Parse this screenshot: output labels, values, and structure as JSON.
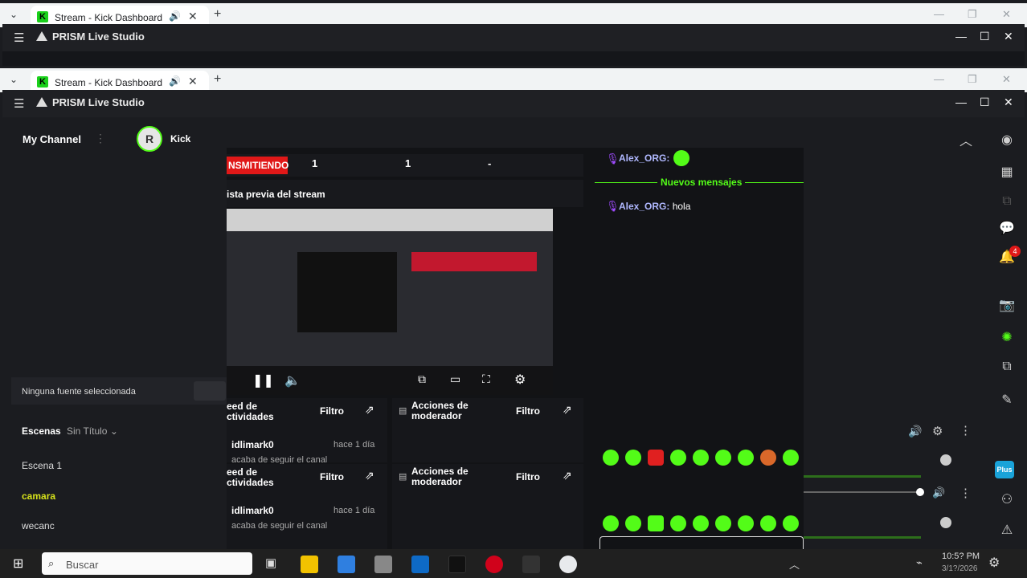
{
  "browser": {
    "tab_title": "Stream - Kick Dashboard"
  },
  "app": {
    "name": "PRISM Live Studio",
    "channel_label": "My Channel",
    "platform": "Kick",
    "avatar_initials": "R"
  },
  "left": {
    "no_source": "Ninguna fuente seleccionada",
    "scenes_label": "Escenas",
    "scene_collection": "Sin Título",
    "scenes": [
      "Escena 1",
      "camara",
      "wecanc"
    ],
    "active_scene": "camara"
  },
  "dashboard": {
    "status": "NSMITIENDO",
    "stat1": "1",
    "stat2": "1",
    "stat3": "-",
    "preview_title": "ista previa del stream",
    "feed_title_1": "eed de",
    "feed_title_2": "ctividades",
    "feed_title_b1": "eed de",
    "feed_title_b2": "ctividades",
    "filter": "Filtro",
    "mod_title_1": "Acciones de",
    "mod_title_2": "moderador",
    "event_user": "idlimark0",
    "event_time": "hace 1 día",
    "event_text": "acaba de seguir el canal"
  },
  "chat": {
    "user": "Alex_ORG",
    "colon": ":",
    "new_messages": "Nuevos mensajes",
    "msg": "hola"
  },
  "taskbar": {
    "search": "Buscar",
    "time": "10:5? PM",
    "date": "3/1?/2026"
  },
  "dock": {
    "plus_label": "Plus",
    "notif_count": "4"
  },
  "colors": {
    "kick_green": "#53fc18",
    "live_red": "#e01818",
    "chat_user": "#b0b8ff",
    "scene_active": "#d6e21b"
  }
}
